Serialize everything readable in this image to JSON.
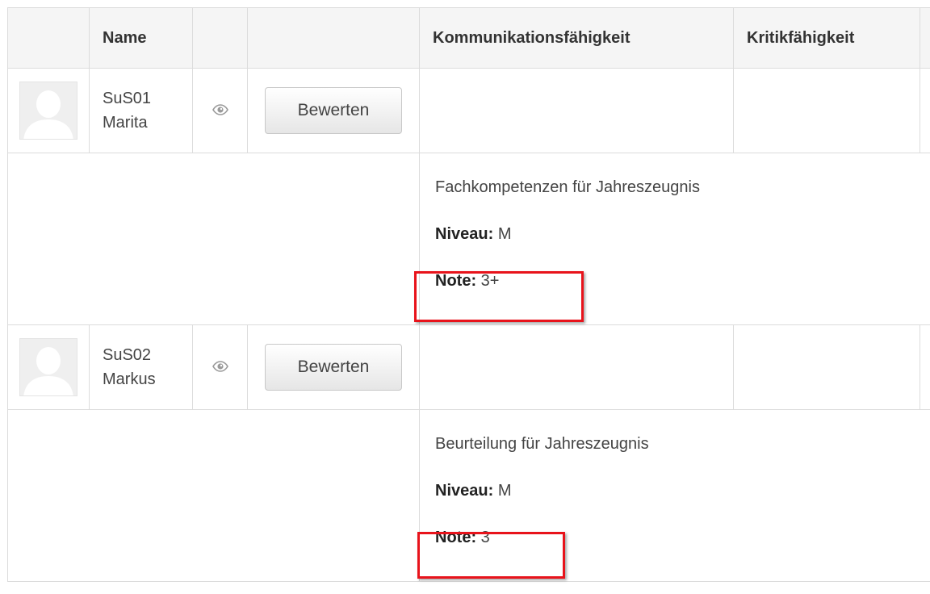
{
  "table": {
    "headers": {
      "name": "Name",
      "comm": "Kommunikationsfähigkeit",
      "crit": "Kritikfähigkeit"
    },
    "students": [
      {
        "code": "SuS01",
        "first_name": "Marita",
        "button_label": "Bewerten",
        "detail": {
          "title": "Fachkompetenzen für Jahreszeugnis",
          "niveau_label": "Niveau:",
          "niveau_value": "M",
          "note_label": "Note:",
          "note_value": "3+"
        }
      },
      {
        "code": "SuS02",
        "first_name": "Markus",
        "button_label": "Bewerten",
        "detail": {
          "title": "Beurteilung für Jahreszeugnis",
          "niveau_label": "Niveau:",
          "niveau_value": "M",
          "note_label": "Note:",
          "note_value": "3"
        }
      }
    ]
  },
  "colors": {
    "highlight": "#e8131b",
    "header_bg": "#f5f5f5",
    "border": "#dcdcdc"
  },
  "icons": [
    "avatar-placeholder-icon",
    "eye-icon"
  ]
}
